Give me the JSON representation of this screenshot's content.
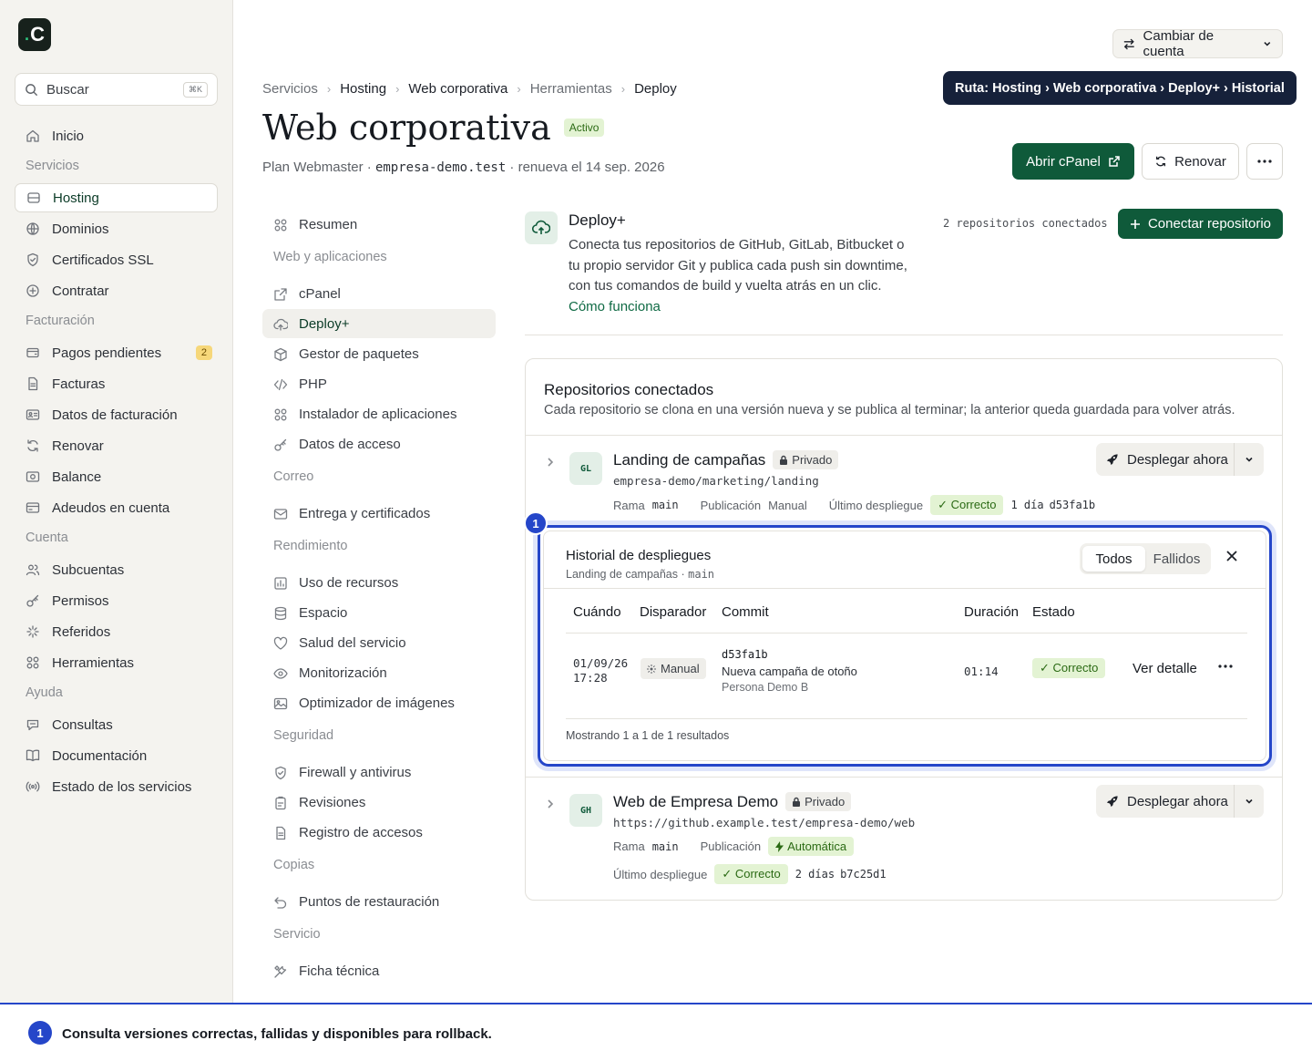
{
  "app": {
    "logo_text": "C"
  },
  "sidebar": {
    "search_placeholder": "Buscar",
    "search_shortcut": "⌘K",
    "items": [
      {
        "label": "Inicio",
        "icon": "home-icon"
      },
      {
        "section": "Servicios"
      },
      {
        "label": "Hosting",
        "icon": "server-icon",
        "active": true
      },
      {
        "label": "Dominios",
        "icon": "globe-icon"
      },
      {
        "label": "Certificados SSL",
        "icon": "shield-icon"
      },
      {
        "label": "Contratar",
        "icon": "plus-circle-icon"
      },
      {
        "section": "Facturación"
      },
      {
        "label": "Pagos pendientes",
        "icon": "wallet-icon",
        "badge": "2"
      },
      {
        "label": "Facturas",
        "icon": "file-icon"
      },
      {
        "label": "Datos de facturación",
        "icon": "id-card-icon"
      },
      {
        "label": "Renovar",
        "icon": "refresh-icon"
      },
      {
        "label": "Balance",
        "icon": "balance-icon"
      },
      {
        "label": "Adeudos en cuenta",
        "icon": "card-icon"
      },
      {
        "section": "Cuenta"
      },
      {
        "label": "Subcuentas",
        "icon": "users-icon"
      },
      {
        "label": "Permisos",
        "icon": "key-icon"
      },
      {
        "label": "Referidos",
        "icon": "sparkle-icon"
      },
      {
        "label": "Herramientas",
        "icon": "grid-icon"
      },
      {
        "section": "Ayuda"
      },
      {
        "label": "Consultas",
        "icon": "chat-icon"
      },
      {
        "label": "Documentación",
        "icon": "book-icon"
      },
      {
        "label": "Estado de los servicios",
        "icon": "broadcast-icon"
      }
    ]
  },
  "header": {
    "switch_account": "Cambiar de cuenta",
    "tooltip": "Ruta: Hosting › Web corporativa › Deploy+ › Historial",
    "breadcrumb": [
      "Servicios",
      "Hosting",
      "Web corporativa",
      "Herramientas",
      "Deploy"
    ],
    "title": "Web corporativa",
    "status": "Activo",
    "plan": "Plan Webmaster",
    "domain": "empresa-demo.test",
    "renewal": "renueva el 14 sep. 2026",
    "btn_cpanel": "Abrir cPanel",
    "btn_renew": "Renovar"
  },
  "subnav": {
    "items": [
      {
        "label": "Resumen",
        "icon": "grid-icon"
      },
      {
        "section": "Web y aplicaciones"
      },
      {
        "label": "cPanel",
        "icon": "external-link-icon"
      },
      {
        "label": "Deploy+",
        "icon": "cloud-upload-icon",
        "active": true
      },
      {
        "label": "Gestor de paquetes",
        "icon": "package-icon"
      },
      {
        "label": "PHP",
        "icon": "code-icon"
      },
      {
        "label": "Instalador de aplicaciones",
        "icon": "grid-icon"
      },
      {
        "label": "Datos de acceso",
        "icon": "key-icon"
      },
      {
        "section": "Correo"
      },
      {
        "label": "Entrega y certificados",
        "icon": "mail-icon"
      },
      {
        "section": "Rendimiento"
      },
      {
        "label": "Uso de recursos",
        "icon": "chart-icon"
      },
      {
        "label": "Espacio",
        "icon": "database-icon"
      },
      {
        "label": "Salud del servicio",
        "icon": "heart-icon"
      },
      {
        "label": "Monitorización",
        "icon": "eye-icon"
      },
      {
        "label": "Optimizador de imágenes",
        "icon": "image-icon"
      },
      {
        "section": "Seguridad"
      },
      {
        "label": "Firewall y antivirus",
        "icon": "shield-icon"
      },
      {
        "label": "Revisiones",
        "icon": "clipboard-icon"
      },
      {
        "label": "Registro de accesos",
        "icon": "file-icon"
      },
      {
        "section": "Copias"
      },
      {
        "label": "Puntos de restauración",
        "icon": "undo-icon"
      },
      {
        "section": "Servicio"
      },
      {
        "label": "Ficha técnica",
        "icon": "tools-icon"
      }
    ]
  },
  "deploy": {
    "title": "Deploy+",
    "description": "Conecta tus repositorios de GitHub, GitLab, Bitbucket o tu propio servidor Git y publica cada push sin downtime, con tus comandos de build y vuelta atrás en un clic.",
    "link": "Cómo funciona",
    "repo_count": "2 repositorios conectados",
    "connect_btn": "Conectar repositorio"
  },
  "repos": {
    "title": "Repositorios conectados",
    "subtitle": "Cada repositorio se clona en una versión nueva y se publica al terminar; la anterior queda guardada para volver atrás.",
    "deploy_label": "Desplegar ahora",
    "branch_label": "Rama",
    "publish_label": "Publicación",
    "last_label": "Último despliegue",
    "list": [
      {
        "avatar": "GL",
        "name": "Landing de campañas",
        "visibility": "Privado",
        "path": "empresa-demo/marketing/landing",
        "branch": "main",
        "publish": "Manual",
        "status": "✓ Correcto",
        "age": "1 día",
        "commit": "d53fa1b"
      },
      {
        "avatar": "GH",
        "name": "Web de Empresa Demo",
        "visibility": "Privado",
        "path": "https://github.example.test/empresa-demo/web",
        "branch": "main",
        "publish": "Automática",
        "status": "✓ Correcto",
        "age": "2 días",
        "commit": "b7c25d1"
      }
    ]
  },
  "history": {
    "marker": "1",
    "title": "Historial de despliegues",
    "sub_repo": "Landing de campañas",
    "sub_branch": "main",
    "tab_all": "Todos",
    "tab_failed": "Fallidos",
    "headers": [
      "Cuándo",
      "Disparador",
      "Commit",
      "Duración",
      "Estado"
    ],
    "row": {
      "date": "01/09/26",
      "time": "17:28",
      "trigger": "Manual",
      "commit": "d53fa1b",
      "message": "Nueva campaña de otoño",
      "author": "Persona Demo B",
      "duration": "01:14",
      "status": "✓ Correcto",
      "detail": "Ver detalle"
    },
    "footer": "Mostrando 1 a 1 de 1 resultados"
  },
  "callout": {
    "marker": "1",
    "text": "Consulta versiones correctas, fallidas y disponibles para rollback."
  },
  "colors": {
    "brand": "#0f5a3a",
    "accent_blue": "#2546c9",
    "success_bg": "#e3f3d3"
  }
}
